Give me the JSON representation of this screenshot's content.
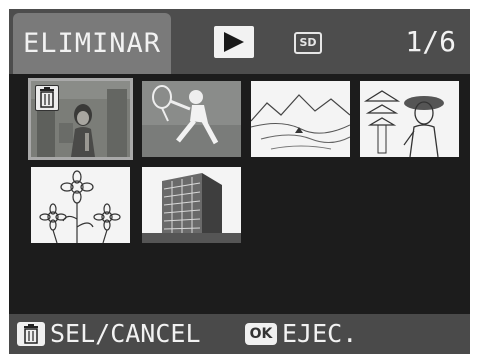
{
  "header": {
    "mode": "ELIMINAR",
    "card_label": "SD",
    "page_indicator": "1/6"
  },
  "thumbnails": [
    {
      "name": "woman-photo",
      "selected": true,
      "marked_delete": true
    },
    {
      "name": "tennis-player-drawing"
    },
    {
      "name": "landscape-drawing"
    },
    {
      "name": "pagoda-woman-drawing"
    },
    {
      "name": "flowers-drawing"
    },
    {
      "name": "building-drawing"
    }
  ],
  "footer": {
    "ok_label": "OK",
    "sel_label": "SEL/CANCEL",
    "exec_label": "EJEC."
  },
  "colors": {
    "screen_bg": "#1c1c1c",
    "bar_bg": "#4a4a4a",
    "tab_bg": "#7a7a7a",
    "text": "#f2f2f2"
  },
  "icons": [
    "play-icon",
    "sd-card-icon",
    "trash-icon",
    "ok-button-icon"
  ]
}
